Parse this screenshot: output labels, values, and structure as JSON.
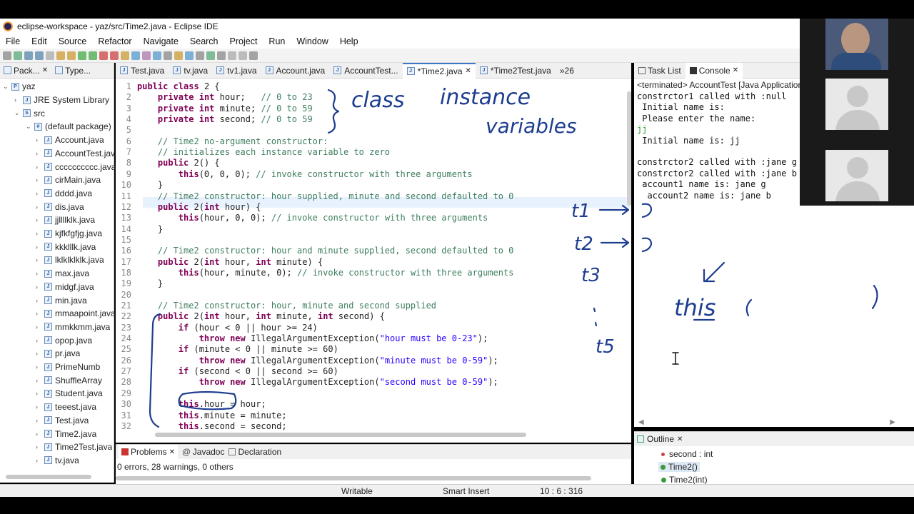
{
  "window": {
    "title": "eclipse-workspace - yaz/src/Time2.java - Eclipse IDE"
  },
  "menu": [
    "File",
    "Edit",
    "Source",
    "Refactor",
    "Navigate",
    "Search",
    "Project",
    "Run",
    "Window",
    "Help"
  ],
  "package_explorer": {
    "tab1": "Pack...",
    "tab2": "Type...",
    "project": "yaz",
    "jre": "JRE System Library",
    "src": "src",
    "default_pkg": "(default package)",
    "files": [
      "Account.java",
      "AccountTest.java",
      "cccccccccc.java",
      "cirMain.java",
      "dddd.java",
      "dis.java",
      "jjllllklk.java",
      "kjfkfgfjg.java",
      "kkklllk.java",
      "lklklklklk.java",
      "max.java",
      "midgf.java",
      "min.java",
      "mmaapoint.java",
      "mmkkmm.java",
      "opop.java",
      "pr.java",
      "PrimeNumb",
      "ShuffleArray",
      "Student.java",
      "teeest.java",
      "Test.java",
      "Time2.java",
      "Time2Test.java",
      "tv.java"
    ]
  },
  "editor": {
    "tabs": [
      "Test.java",
      "tv.java",
      "tv1.java",
      "Account.java",
      "AccountTest...",
      "*Time2.java",
      "*Time2Test.java",
      "»26"
    ],
    "active_tab": "*Time2.java",
    "lines": [
      {
        "n": "1",
        "t": "public class Time2 {"
      },
      {
        "n": "2",
        "t": "    private int hour;   // 0 to 23"
      },
      {
        "n": "3",
        "t": "    private int minute; // 0 to 59"
      },
      {
        "n": "4",
        "t": "    private int second; // 0 to 59"
      },
      {
        "n": "5",
        "t": ""
      },
      {
        "n": "6",
        "t": "    // Time2 no-argument constructor:"
      },
      {
        "n": "7",
        "t": "    // initializes each instance variable to zero"
      },
      {
        "n": "8",
        "t": "    public Time2() {"
      },
      {
        "n": "9",
        "t": "        this(0, 0, 0); // invoke constructor with three arguments"
      },
      {
        "n": "10",
        "t": "    }"
      },
      {
        "n": "11",
        "t": "    // Time2 constructor: hour supplied, minute and second defaulted to 0"
      },
      {
        "n": "12",
        "t": "    public Time2(int hour) {"
      },
      {
        "n": "13",
        "t": "        this(hour, 0, 0); // invoke constructor with three arguments"
      },
      {
        "n": "14",
        "t": "    }"
      },
      {
        "n": "15",
        "t": ""
      },
      {
        "n": "16",
        "t": "    // Time2 constructor: hour and minute supplied, second defaulted to 0"
      },
      {
        "n": "17",
        "t": "    public Time2(int hour, int minute) {"
      },
      {
        "n": "18",
        "t": "        this(hour, minute, 0); // invoke constructor with three arguments"
      },
      {
        "n": "19",
        "t": "    }"
      },
      {
        "n": "20",
        "t": ""
      },
      {
        "n": "21",
        "t": "    // Time2 constructor: hour, minute and second supplied"
      },
      {
        "n": "22",
        "t": "    public Time2(int hour, int minute, int second) {"
      },
      {
        "n": "23",
        "t": "        if (hour < 0 || hour >= 24)"
      },
      {
        "n": "24",
        "t": "            throw new IllegalArgumentException(\"hour must be 0-23\");"
      },
      {
        "n": "25",
        "t": "        if (minute < 0 || minute >= 60)"
      },
      {
        "n": "26",
        "t": "            throw new IllegalArgumentException(\"minute must be 0-59\");"
      },
      {
        "n": "27",
        "t": "        if (second < 0 || second >= 60)"
      },
      {
        "n": "28",
        "t": "            throw new IllegalArgumentException(\"second must be 0-59\");"
      },
      {
        "n": "29",
        "t": ""
      },
      {
        "n": "30",
        "t": "        this.hour = hour;"
      },
      {
        "n": "31",
        "t": "        this.minute = minute;"
      },
      {
        "n": "32",
        "t": "        this.second = second;"
      }
    ]
  },
  "console": {
    "tab1": "Task List",
    "tab2": "Console",
    "header": "<terminated> AccountTest [Java Application]",
    "lines": [
      "constrctor1 called with :null",
      " Initial name is:",
      " Please enter the name:",
      "jj",
      " Initial name is: jj",
      "",
      "constrctor2 called with :jane g",
      "constrctor2 called with :jane b",
      " account1 name is: jane g",
      "  account2 name is: jane b"
    ]
  },
  "outline": {
    "tab": "Outline",
    "items": [
      "second : int",
      "Time2()",
      "Time2(int)"
    ]
  },
  "problems": {
    "tab1": "Problems",
    "tab2": "Javadoc",
    "tab3": "Declaration",
    "summary": "0 errors, 28 warnings, 0 others"
  },
  "status": {
    "mode": "Writable",
    "insert": "Smart Insert",
    "pos": "10 : 6 : 316"
  },
  "annotations": {
    "class_note": "class",
    "instance_note": "instance",
    "variables_note": "variables",
    "t1": "t1",
    "t2": "t2",
    "t3": "t3",
    "t5": "t5",
    "this_call": "this"
  },
  "colors": {
    "keyword": "#7f0055",
    "comment": "#3f7f5f",
    "string": "#2a00ff",
    "ink": "#1d3d8f"
  }
}
